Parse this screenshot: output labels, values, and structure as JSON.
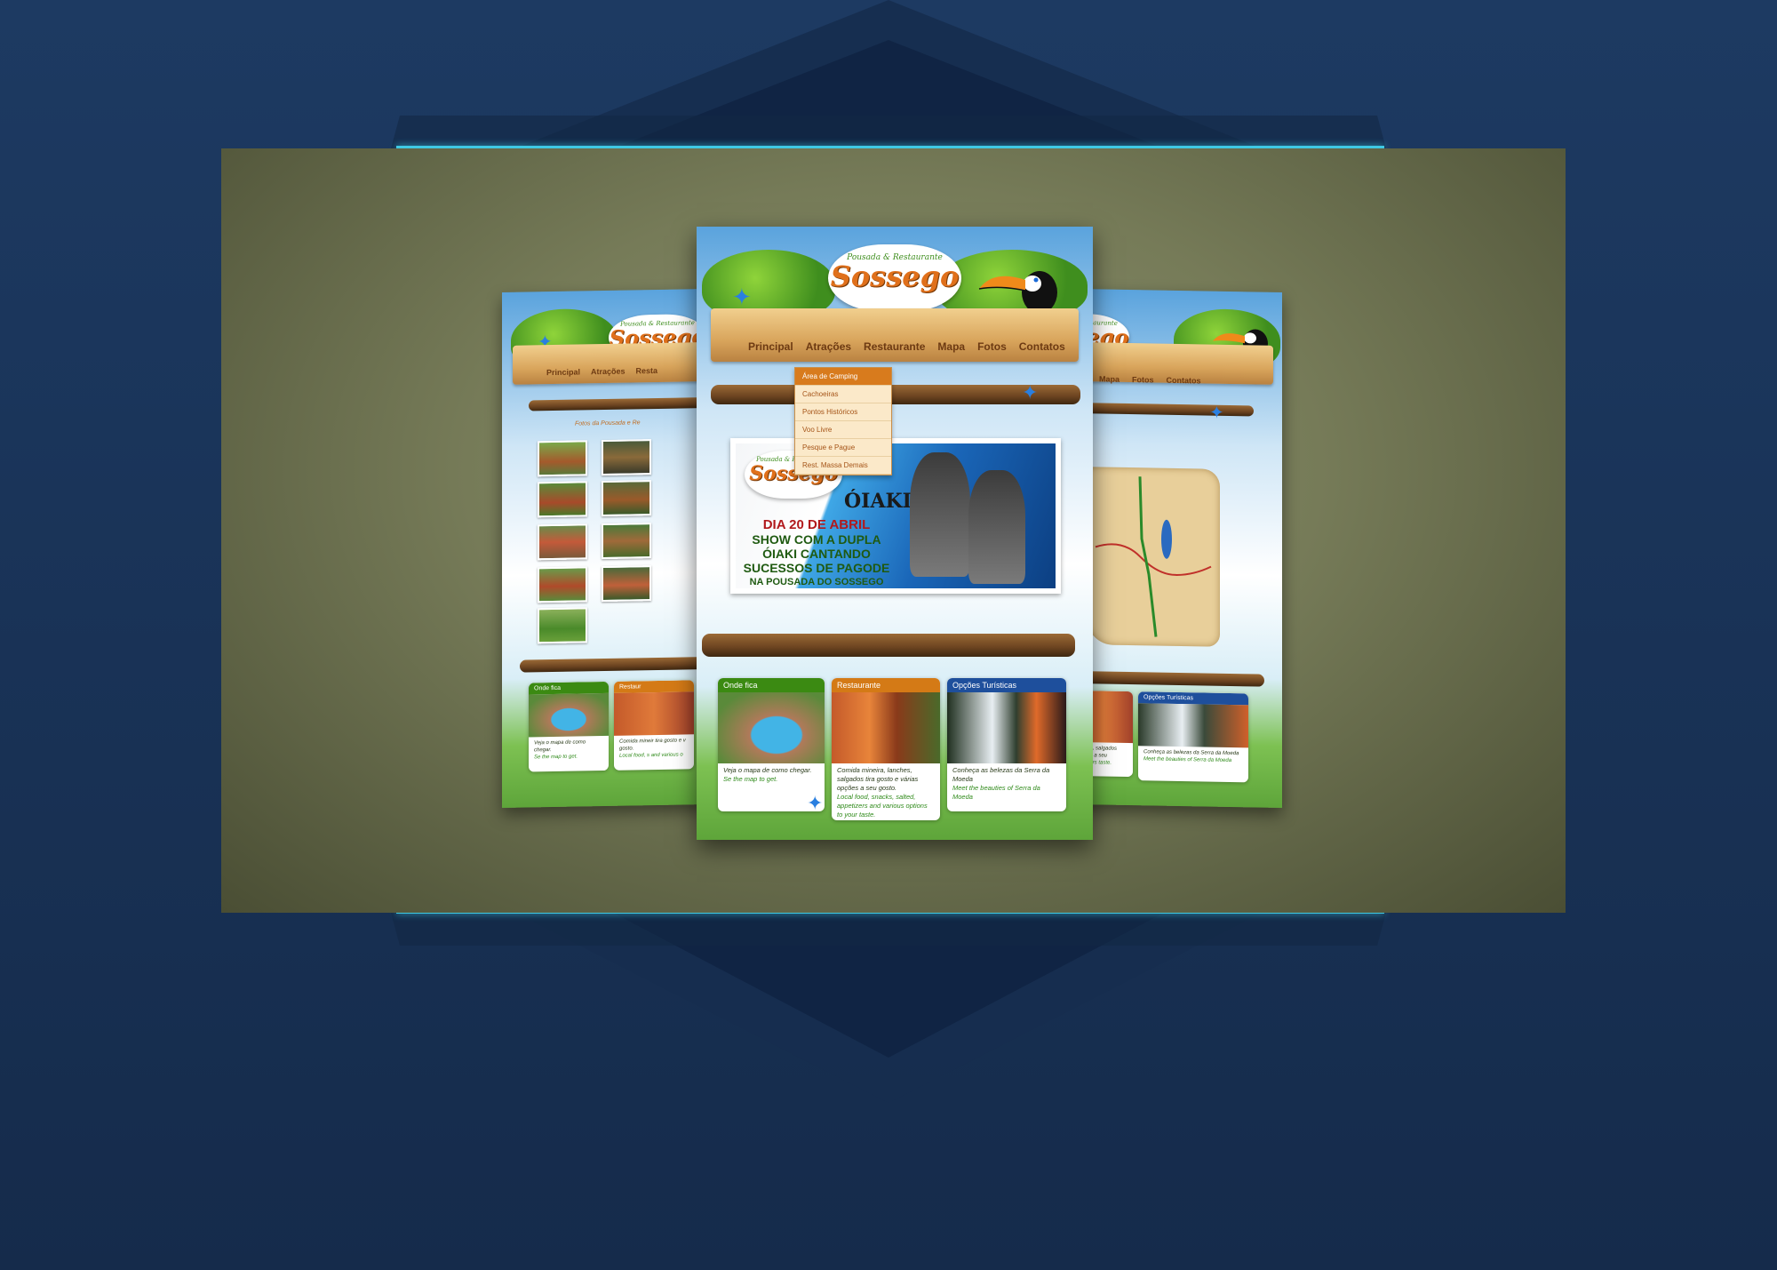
{
  "brand": {
    "subtitle": "Pousada & Restaurante",
    "name": "Sossego"
  },
  "nav": [
    "Principal",
    "Atrações",
    "Restaurante",
    "Mapa",
    "Fotos",
    "Contatos"
  ],
  "nav_left": [
    "Principal",
    "Atrações",
    "Resta"
  ],
  "nav_right": [
    "Mapa",
    "Fotos",
    "Contatos"
  ],
  "dropdown": [
    "Área de Camping",
    "Cachoeiras",
    "Pontos Históricos",
    "Voo Livre",
    "Pesque e Pague",
    "Rest. Massa Demais"
  ],
  "left_title": "Fotos da Pousada e Re",
  "banner": {
    "logo_subtitle": "Pousada & Restaurante",
    "logo_name": "Sossego",
    "band": "ÓIAKI",
    "line1": "DIA 20 DE ABRIL",
    "line2": "SHOW COM A DUPLA",
    "line3": "ÓIAKI CANTANDO",
    "line4": "SUCESSOS DE PAGODE",
    "line5": "NA POUSADA DO SOSSEGO"
  },
  "cards": [
    {
      "title": "Onde fica",
      "color": "#3b8a12",
      "pt": "Veja o mapa de como chegar.",
      "en": "Se the map to get."
    },
    {
      "title": "Restaurante",
      "color": "#d47a16",
      "pt": "Comida mineira, lanches, salgados tira gosto e várias opções a seu gosto.",
      "en": "Local food, snacks, salted, appetizers and various options to your taste."
    },
    {
      "title": "Opções Turísticas",
      "color": "#1e4f9c",
      "pt": "Conheça as belezas da Serra da Moeda",
      "en": "Meet the beauties of Serra da Moeda"
    }
  ],
  "left_cards": [
    {
      "title": "Onde fica",
      "pt": "Veja o mapa de como chegar.",
      "en": "Se the map to get."
    },
    {
      "title": "Restaur",
      "pt": "Comida mineir tira gosto e v gosto.",
      "en": "Local food, s and various o"
    }
  ],
  "right_cards": [
    {
      "title": "",
      "pt": "ches, salgados ções a seu",
      "en": "etizers taste."
    },
    {
      "title": "Opções Turísticas",
      "pt": "Conheça as belezas da Serra da Moeda",
      "en": "Meet the beauties of Serra da Moeda"
    }
  ],
  "colors": {
    "accent": "#3fc9e4",
    "frame_bg": "#1a3458",
    "stage": "#767b58"
  }
}
